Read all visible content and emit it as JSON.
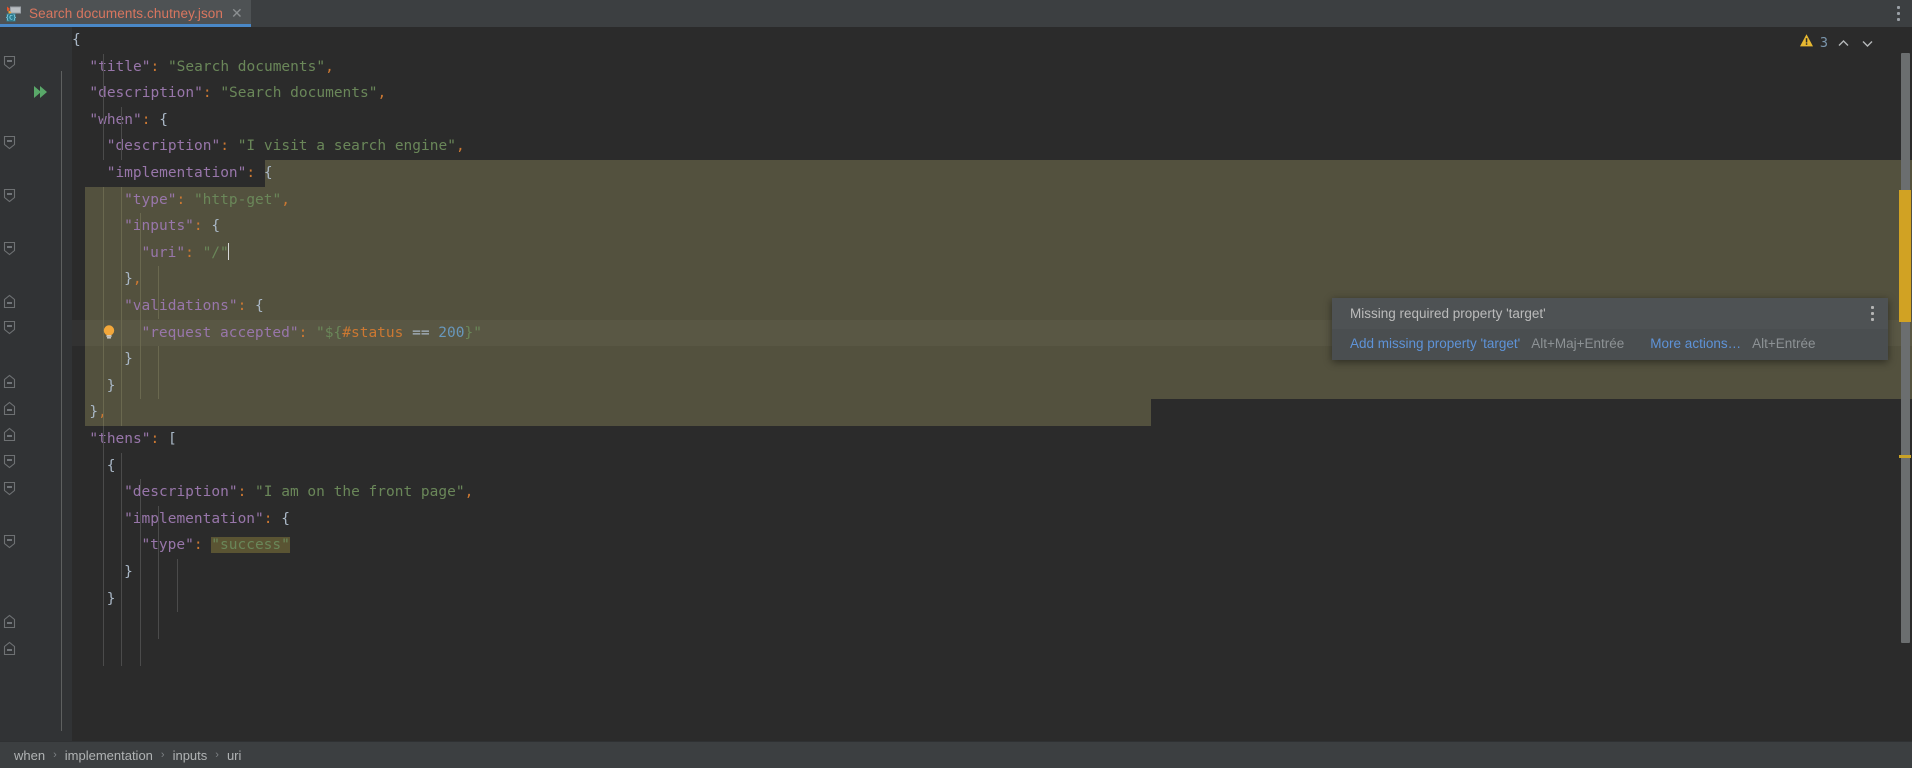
{
  "window": {
    "background": "#2b2b2b",
    "panel_background": "#3c3f41",
    "accent": "#4a88c7",
    "highlight_block": "#53513e"
  },
  "tab": {
    "label": "Search documents.chutney.json",
    "icon": "json-chutney-file-icon",
    "close_icon": "close-icon",
    "active": true
  },
  "titlebar": {
    "overflow_menu_icon": "more-vertical-icon"
  },
  "inspection_widget": {
    "warning_icon": "warning-triangle-icon",
    "warning_count": "3",
    "prev_icon": "chevron-up-icon",
    "next_icon": "chevron-down-icon"
  },
  "gutter": {
    "run_icon": "run-double-chevron-icon",
    "run_icon_line": 2,
    "intention_bulb_icon": "lightbulb-icon",
    "intention_bulb_line": 9,
    "current_line": 9
  },
  "editor": {
    "caret_line": 9,
    "caret_column": 17,
    "lines": [
      {
        "n": "1",
        "indent": 0,
        "tokens": [
          {
            "t": "{",
            "c": "b"
          }
        ]
      },
      {
        "n": "2",
        "indent": 1,
        "tokens": [
          {
            "t": "\"title\"",
            "c": "k"
          },
          {
            "t": ":",
            "c": "p"
          },
          {
            "t": " ",
            "c": "op"
          },
          {
            "t": "\"Search documents\"",
            "c": "s"
          },
          {
            "t": ",",
            "c": "p"
          }
        ]
      },
      {
        "n": "3",
        "indent": 1,
        "tokens": [
          {
            "t": "\"description\"",
            "c": "k"
          },
          {
            "t": ":",
            "c": "p"
          },
          {
            "t": " ",
            "c": "op"
          },
          {
            "t": "\"Search documents\"",
            "c": "s"
          },
          {
            "t": ",",
            "c": "p"
          }
        ]
      },
      {
        "n": "4",
        "indent": 1,
        "tokens": [
          {
            "t": "\"when\"",
            "c": "k"
          },
          {
            "t": ":",
            "c": "p"
          },
          {
            "t": " ",
            "c": "op"
          },
          {
            "t": "{",
            "c": "b"
          }
        ]
      },
      {
        "n": "5",
        "indent": 2,
        "tokens": [
          {
            "t": "\"description\"",
            "c": "k"
          },
          {
            "t": ":",
            "c": "p"
          },
          {
            "t": " ",
            "c": "op"
          },
          {
            "t": "\"I visit a search engine\"",
            "c": "s"
          },
          {
            "t": ",",
            "c": "p"
          }
        ]
      },
      {
        "n": "6",
        "indent": 2,
        "tokens": [
          {
            "t": "\"implementation\"",
            "c": "k"
          },
          {
            "t": ":",
            "c": "p"
          },
          {
            "t": " ",
            "c": "op"
          },
          {
            "t": "{",
            "c": "b"
          }
        ]
      },
      {
        "n": "7",
        "indent": 3,
        "tokens": [
          {
            "t": "\"type\"",
            "c": "k"
          },
          {
            "t": ":",
            "c": "p"
          },
          {
            "t": " ",
            "c": "op"
          },
          {
            "t": "\"http-get\"",
            "c": "s"
          },
          {
            "t": ",",
            "c": "p"
          }
        ]
      },
      {
        "n": "8",
        "indent": 3,
        "tokens": [
          {
            "t": "\"inputs\"",
            "c": "k"
          },
          {
            "t": ":",
            "c": "p"
          },
          {
            "t": " ",
            "c": "op"
          },
          {
            "t": "{",
            "c": "b"
          }
        ]
      },
      {
        "n": "9",
        "indent": 4,
        "tokens": [
          {
            "t": "\"uri\"",
            "c": "k"
          },
          {
            "t": ":",
            "c": "p"
          },
          {
            "t": " ",
            "c": "op"
          },
          {
            "t": "\"/\"",
            "c": "s"
          }
        ]
      },
      {
        "n": "10",
        "indent": 3,
        "tokens": [
          {
            "t": "}",
            "c": "b"
          },
          {
            "t": ",",
            "c": "p"
          }
        ]
      },
      {
        "n": "11",
        "indent": 3,
        "tokens": [
          {
            "t": "\"validations\"",
            "c": "k"
          },
          {
            "t": ":",
            "c": "p"
          },
          {
            "t": " ",
            "c": "op"
          },
          {
            "t": "{",
            "c": "b"
          }
        ]
      },
      {
        "n": "12",
        "indent": 4,
        "tokens": [
          {
            "t": "\"request accepted\"",
            "c": "k"
          },
          {
            "t": ":",
            "c": "p"
          },
          {
            "t": " ",
            "c": "op"
          },
          {
            "t": "\"${",
            "c": "s"
          },
          {
            "t": "#status",
            "c": "var"
          },
          {
            "t": " == ",
            "c": "op"
          },
          {
            "t": "200",
            "c": "num"
          },
          {
            "t": "}\"",
            "c": "s"
          }
        ]
      },
      {
        "n": "13",
        "indent": 3,
        "tokens": [
          {
            "t": "}",
            "c": "b"
          }
        ]
      },
      {
        "n": "14",
        "indent": 2,
        "tokens": [
          {
            "t": "}",
            "c": "b"
          }
        ]
      },
      {
        "n": "15",
        "indent": 1,
        "tokens": [
          {
            "t": "}",
            "c": "b"
          },
          {
            "t": ",",
            "c": "p"
          }
        ]
      },
      {
        "n": "16",
        "indent": 1,
        "tokens": [
          {
            "t": "\"thens\"",
            "c": "k"
          },
          {
            "t": ":",
            "c": "p"
          },
          {
            "t": " ",
            "c": "op"
          },
          {
            "t": "[",
            "c": "b"
          }
        ]
      },
      {
        "n": "17",
        "indent": 2,
        "tokens": [
          {
            "t": "{",
            "c": "b"
          }
        ]
      },
      {
        "n": "18",
        "indent": 3,
        "tokens": [
          {
            "t": "\"description\"",
            "c": "k"
          },
          {
            "t": ":",
            "c": "p"
          },
          {
            "t": " ",
            "c": "op"
          },
          {
            "t": "\"I am on the front page\"",
            "c": "s"
          },
          {
            "t": ",",
            "c": "p"
          }
        ]
      },
      {
        "n": "19",
        "indent": 3,
        "tokens": [
          {
            "t": "\"implementation\"",
            "c": "k"
          },
          {
            "t": ":",
            "c": "p"
          },
          {
            "t": " ",
            "c": "op"
          },
          {
            "t": "{",
            "c": "b"
          }
        ]
      },
      {
        "n": "20",
        "indent": 4,
        "tokens": [
          {
            "t": "\"type\"",
            "c": "k"
          },
          {
            "t": ":",
            "c": "p"
          },
          {
            "t": " ",
            "c": "op"
          },
          {
            "t": "\"success\"",
            "c": "s occ"
          }
        ]
      },
      {
        "n": "21",
        "indent": 3,
        "tokens": [
          {
            "t": "}",
            "c": "b"
          }
        ]
      },
      {
        "n": "22",
        "indent": 2,
        "tokens": [
          {
            "t": "}",
            "c": "b"
          }
        ]
      }
    ]
  },
  "intention_popup": {
    "title": "Missing required property 'target'",
    "menu_icon": "more-vertical-icon",
    "primary_action": "Add missing property 'target'",
    "primary_shortcut": "Alt+Maj+Entrée",
    "secondary_action": "More actions…",
    "secondary_shortcut": "Alt+Entrée"
  },
  "breadcrumb": {
    "separator": "›",
    "items": [
      {
        "label": "when"
      },
      {
        "label": "implementation"
      },
      {
        "label": "inputs"
      },
      {
        "label": "uri"
      }
    ]
  }
}
